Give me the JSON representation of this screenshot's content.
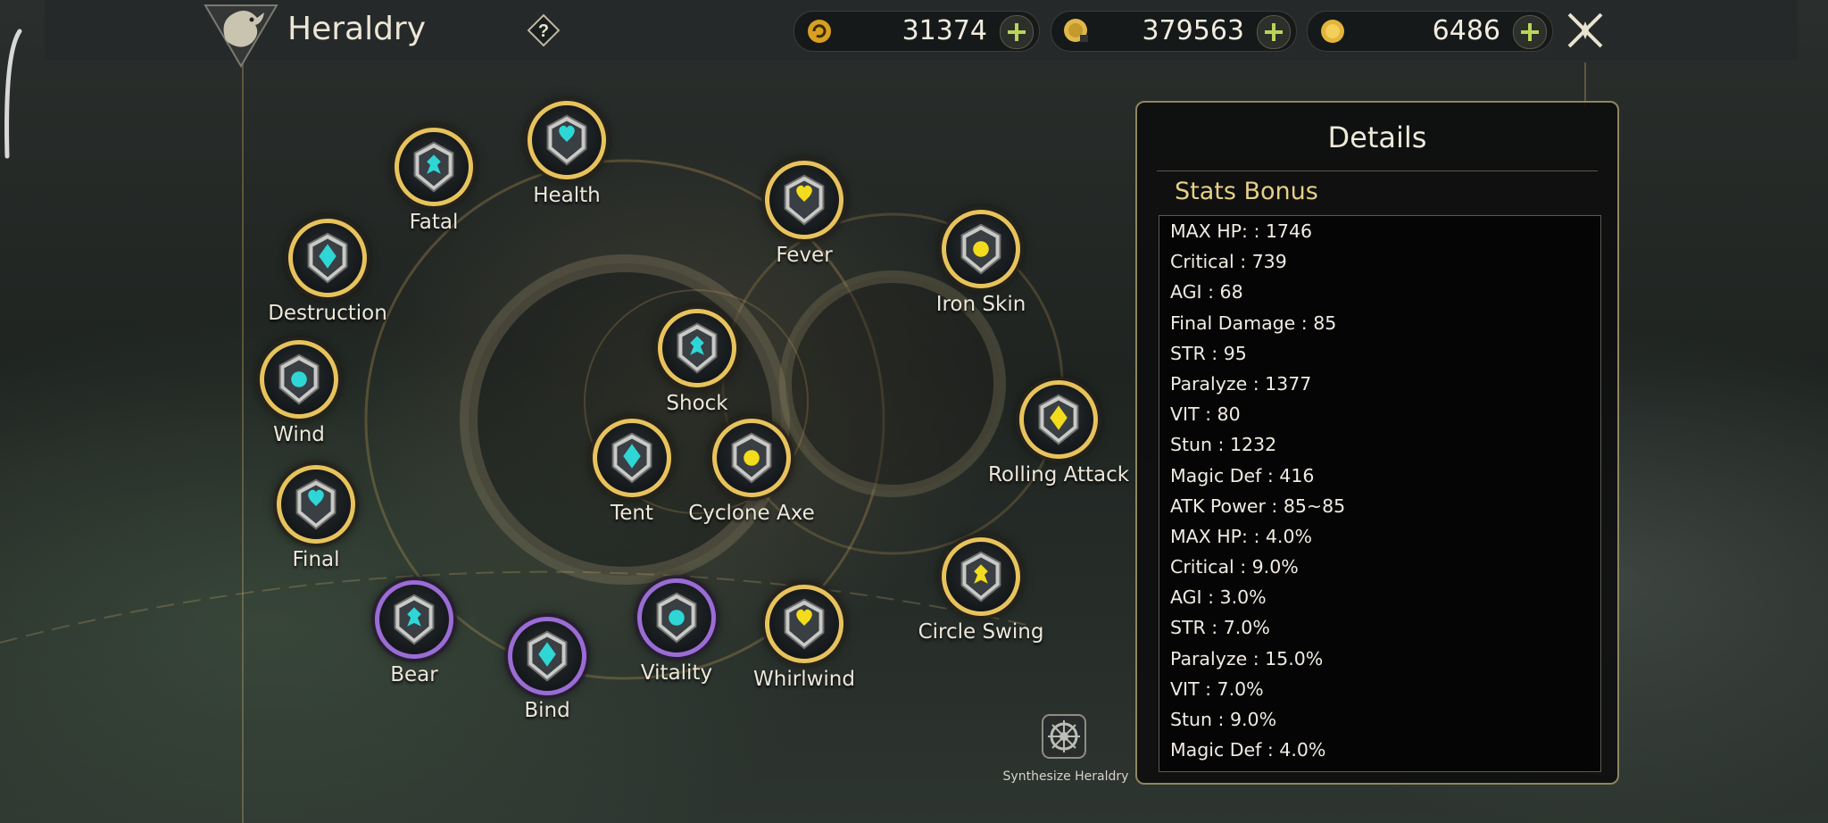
{
  "header": {
    "title": "Heraldry",
    "help_icon": "question-icon",
    "currencies": [
      {
        "name": "refresh-coin",
        "value": "31374"
      },
      {
        "name": "locked-coin",
        "value": "379563"
      },
      {
        "name": "gold-coin",
        "value": "6486"
      }
    ]
  },
  "nodes": [
    {
      "label": "Health",
      "color": "cyan",
      "ring": "gold"
    },
    {
      "label": "Fatal",
      "color": "cyan",
      "ring": "gold"
    },
    {
      "label": "Destruction",
      "color": "cyan",
      "ring": "gold"
    },
    {
      "label": "Wind",
      "color": "cyan",
      "ring": "gold"
    },
    {
      "label": "Final",
      "color": "cyan",
      "ring": "gold"
    },
    {
      "label": "Bear",
      "color": "cyan",
      "ring": "purple"
    },
    {
      "label": "Bind",
      "color": "cyan",
      "ring": "purple"
    },
    {
      "label": "Vitality",
      "color": "cyan",
      "ring": "purple"
    },
    {
      "label": "Whirlwind",
      "color": "yellow",
      "ring": "gold"
    },
    {
      "label": "Circle Swing",
      "color": "yellow",
      "ring": "gold"
    },
    {
      "label": "Rolling Attack",
      "color": "yellow",
      "ring": "gold"
    },
    {
      "label": "Iron Skin",
      "color": "yellow",
      "ring": "gold"
    },
    {
      "label": "Fever",
      "color": "yellow",
      "ring": "gold"
    },
    {
      "label": "Shock",
      "color": "cyan",
      "ring": "gold"
    },
    {
      "label": "Tent",
      "color": "cyan",
      "ring": "gold"
    },
    {
      "label": "Cyclone Axe",
      "color": "yellow",
      "ring": "gold"
    }
  ],
  "details": {
    "title": "Details",
    "section": "Stats Bonus",
    "stats": [
      "MAX HP: : 1746",
      "Critical : 739",
      "AGI : 68",
      "Final Damage : 85",
      "STR : 95",
      "Paralyze : 1377",
      "VIT : 80",
      "Stun : 1232",
      "Magic Def : 416",
      "ATK Power : 85~85",
      "MAX HP: : 4.0%",
      "Critical : 9.0%",
      "AGI : 3.0%",
      "STR : 7.0%",
      "Paralyze : 15.0%",
      "VIT : 7.0%",
      "Stun : 9.0%",
      "Magic Def : 4.0%"
    ]
  },
  "synthesize": {
    "label": "Synthesize Heraldry"
  },
  "colors": {
    "cyan": "#2fd6d6",
    "yellow": "#f2dc1c",
    "gold": "#e8c35c",
    "purple": "#9b6cd6"
  }
}
